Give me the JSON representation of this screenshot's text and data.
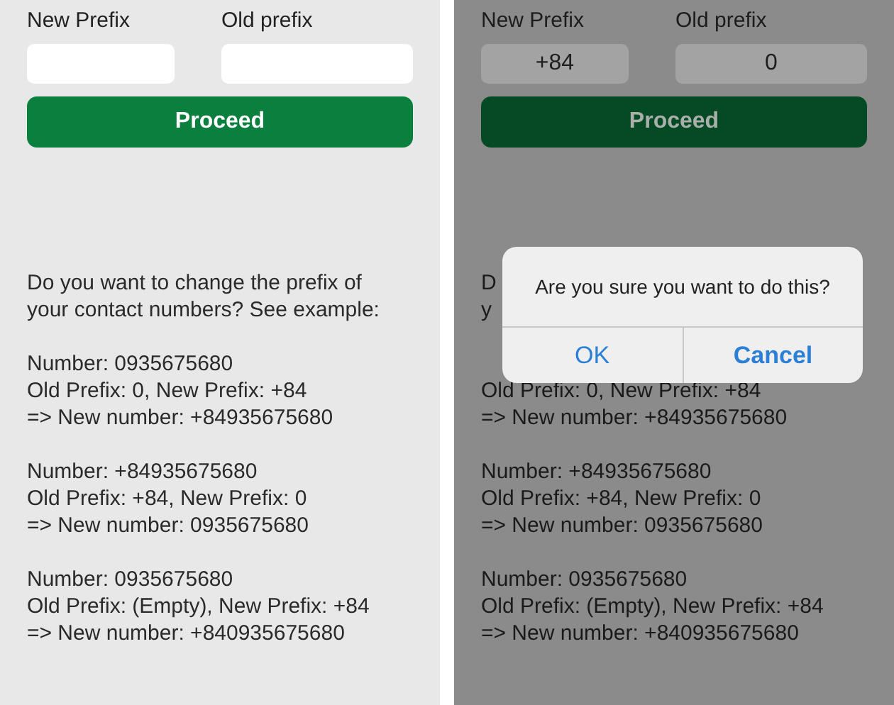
{
  "screens": [
    {
      "dimmed": false,
      "fields": [
        {
          "label": "New Prefix"
        },
        {
          "label": "Old prefix"
        }
      ],
      "button": "Proceed",
      "intro": [
        "Do you want to change the prefix of",
        "your contact numbers? See example:"
      ],
      "examples": [
        [
          "Number: 0935675680",
          "Old Prefix: 0, New Prefix: +84",
          "=> New number: +84935675680"
        ],
        [
          "Number: +84935675680",
          "Old Prefix: +84, New Prefix: 0",
          "=> New number: 0935675680"
        ],
        [
          "Number: 0935675680",
          "Old Prefix: (Empty), New Prefix: +84",
          "=> New number: +840935675680"
        ]
      ]
    },
    {
      "dimmed": true,
      "fields": [
        {
          "label": "New Prefix",
          "value": "+84"
        },
        {
          "label": "Old prefix",
          "value": "0"
        }
      ],
      "button": "Proceed",
      "intro": [
        "D",
        "y"
      ],
      "examples": [
        [
          "Old Prefix: 0, New Prefix: +84",
          "=> New number: +84935675680"
        ],
        [
          "Number: +84935675680",
          "Old Prefix: +84, New Prefix: 0",
          "=> New number: 0935675680"
        ],
        [
          "Number: 0935675680",
          "Old Prefix: (Empty), New Prefix: +84",
          "=> New number: +840935675680"
        ]
      ],
      "dialog": {
        "message": "Are you sure you want to do this?",
        "buttons": [
          "OK",
          "Cancel"
        ]
      }
    }
  ]
}
